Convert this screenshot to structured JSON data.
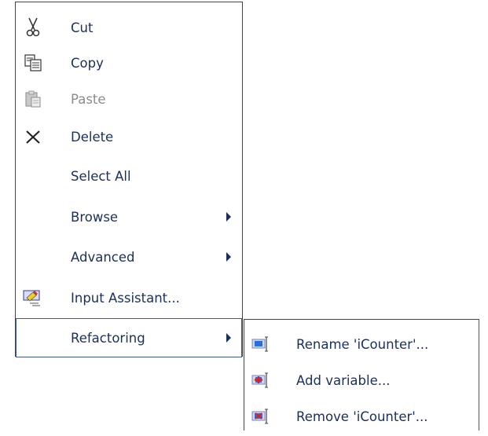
{
  "context_menu": {
    "items": [
      {
        "label": "Cut",
        "icon": "scissors-icon",
        "enabled": true
      },
      {
        "label": "Copy",
        "icon": "copy-icon",
        "enabled": true
      },
      {
        "label": "Paste",
        "icon": "paste-icon",
        "enabled": false
      },
      {
        "label": "Delete",
        "icon": "delete-x-icon",
        "enabled": true
      },
      {
        "label": "Select All",
        "icon": "",
        "enabled": true
      },
      {
        "label": "Browse",
        "icon": "",
        "enabled": true,
        "submenu": true
      },
      {
        "label": "Advanced",
        "icon": "",
        "enabled": true,
        "submenu": true
      },
      {
        "label": "Input Assistant...",
        "icon": "input-assistant-icon",
        "enabled": true
      },
      {
        "label": "Refactoring",
        "icon": "",
        "enabled": true,
        "submenu": true,
        "selected": true
      }
    ]
  },
  "refactoring_submenu": {
    "items": [
      {
        "label": "Rename 'iCounter'...",
        "icon": "rename-variable-icon"
      },
      {
        "label": "Add variable...",
        "icon": "add-variable-icon"
      },
      {
        "label": "Remove 'iCounter'...",
        "icon": "remove-variable-icon"
      }
    ]
  },
  "colors": {
    "text": "#1a2f5e",
    "disabled_text": "#8b8b8b",
    "border": "#444444",
    "selection_border": "#3c5a8c"
  }
}
